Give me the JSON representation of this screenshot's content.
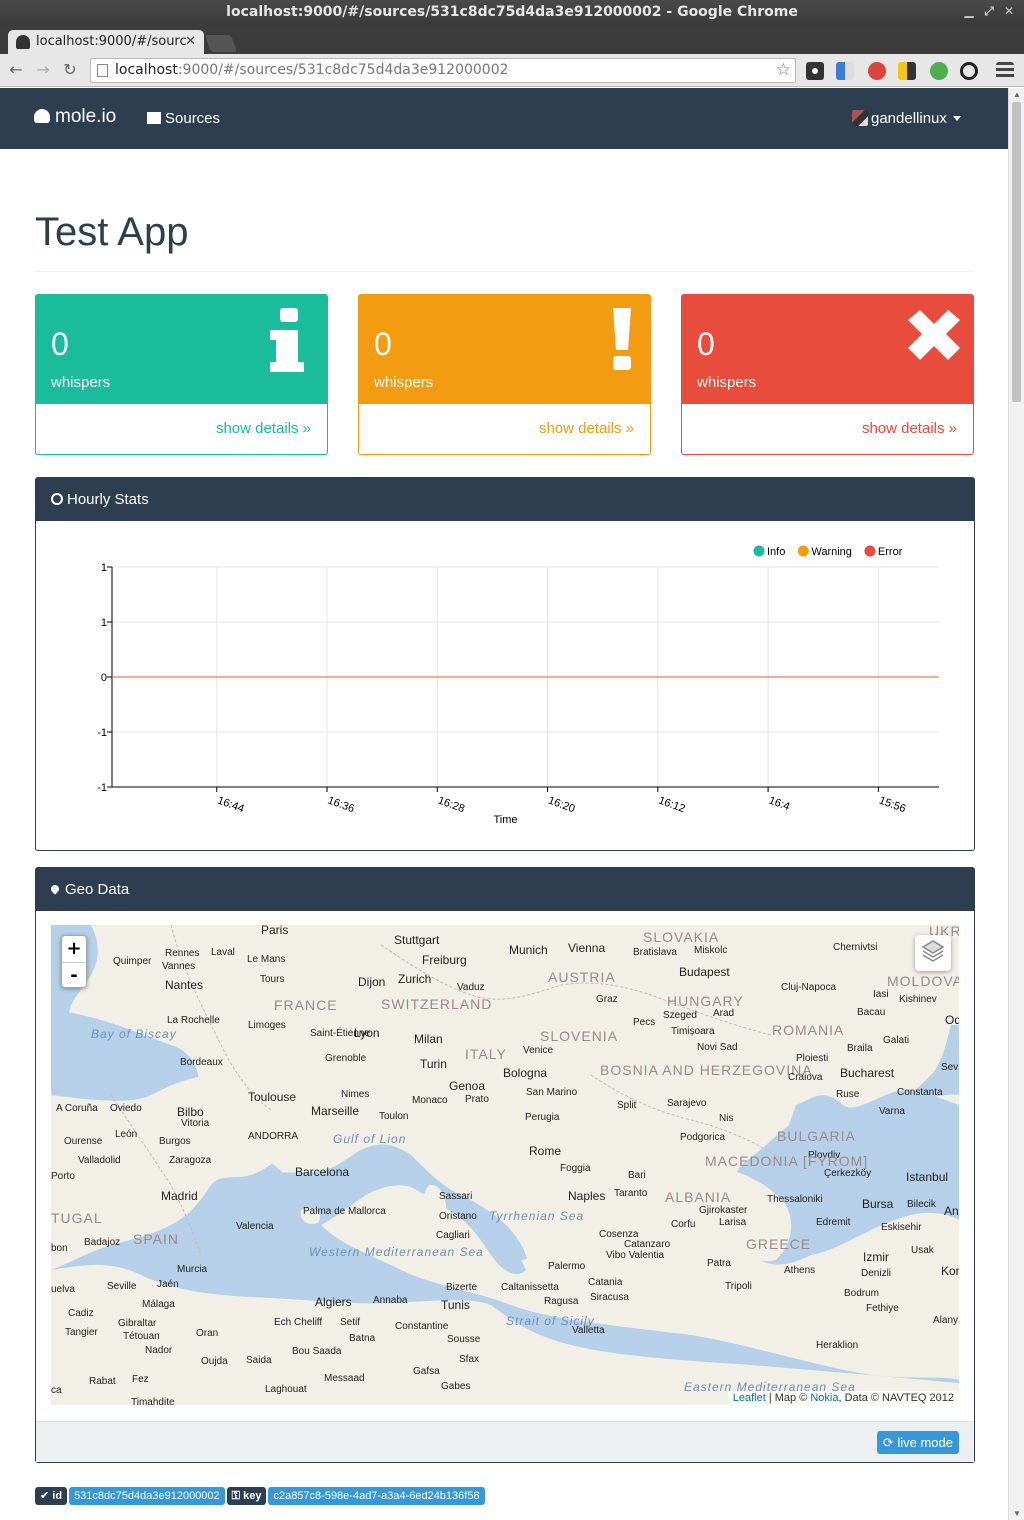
{
  "window": {
    "title": "localhost:9000/#/sources/531c8dc75d4da3e912000002 - Google Chrome"
  },
  "tab": {
    "title": "localhost:9000/#/sourc"
  },
  "omnibox": {
    "host": "localhost",
    "path": ":9000/#/sources/531c8dc75d4da3e912000002"
  },
  "navbar": {
    "brand": "mole.io",
    "sources": "Sources",
    "user": "gandellinux"
  },
  "page": {
    "title": "Test App"
  },
  "cards": [
    {
      "count": "0",
      "label": "whispers",
      "link": "show details »",
      "color": "#1abc9c",
      "icon": "info-icon"
    },
    {
      "count": "0",
      "label": "whispers",
      "link": "show details »",
      "color": "#f39c12",
      "icon": "exclamation-icon"
    },
    {
      "count": "0",
      "label": "whispers",
      "link": "show details »",
      "color": "#e74c3c",
      "icon": "times-icon"
    }
  ],
  "stats_panel": {
    "title": "Hourly Stats"
  },
  "chart_data": {
    "type": "line",
    "title": "",
    "xlabel": "Time",
    "ylabel": "",
    "categories": [
      "16:44",
      "16:36",
      "16:28",
      "16:20",
      "16:12",
      "16:4",
      "15:56"
    ],
    "yticks": [
      "1",
      "1",
      "0",
      "-1",
      "-1"
    ],
    "ylim": [
      -1,
      1
    ],
    "series": [
      {
        "name": "Info",
        "color": "#1abc9c",
        "values": [
          0,
          0,
          0,
          0,
          0,
          0,
          0
        ]
      },
      {
        "name": "Warning",
        "color": "#f39c12",
        "values": [
          0,
          0,
          0,
          0,
          0,
          0,
          0
        ]
      },
      {
        "name": "Error",
        "color": "#e74c3c",
        "values": [
          0,
          0,
          0,
          0,
          0,
          0,
          0
        ]
      }
    ],
    "grid": true,
    "legend": "top-right"
  },
  "geo_panel": {
    "title": "Geo Data",
    "live_mode": "live mode"
  },
  "map": {
    "attribution_leaflet": "Leaflet",
    "attribution_mid": " | Map © ",
    "attribution_nokia": "Nokia",
    "attribution_end": ", Data © NAVTEQ 2012",
    "labels": {
      "paris": "Paris",
      "stuttgart": "Stuttgart",
      "munich": "Munich",
      "vienna": "Vienna",
      "slovakia": "SLOVAKIA",
      "bratislava": "Bratislava",
      "miskolc": "Miskolc",
      "budapest": "Budapest",
      "chernivtsi": "Chernivtsi",
      "rennes": "Rennes",
      "quimper": "Quimper",
      "vannes": "Vannes",
      "laval": "Laval",
      "lemans": "Le Mans",
      "freiburg": "Freiburg",
      "austria": "AUSTRIA",
      "clujnapoca": "Cluj-Napoca",
      "moldova": "MOLDOVA",
      "nantes": "Nantes",
      "tours": "Tours",
      "dijon": "Dijon",
      "zurich": "Zurich",
      "vaduz": "Vaduz",
      "graz": "Graz",
      "hungary": "HUNGARY",
      "iasi": "Iasi",
      "kishinev": "Kishinev",
      "france": "FRANCE",
      "switzerland": "SWITZERLAND",
      "pecs": "Pecs",
      "szeged": "Szeged",
      "arad": "Arad",
      "bacau": "Bacau",
      "bayofbiscay": "Bay of Biscay",
      "larochelle": "La Rochelle",
      "limoges": "Limoges",
      "saintetienne": "Saint-Étienne",
      "lyon": "Lyon",
      "milan": "Milan",
      "slovenia": "SLOVENIA",
      "timisoara": "Timișoara",
      "romania": "ROMANIA",
      "galati": "Galati",
      "grenoble": "Grenoble",
      "italy": "ITALY",
      "venice": "Venice",
      "novisad": "Novi Sad",
      "braila": "Braila",
      "bordeaux": "Bordeaux",
      "turin": "Turin",
      "bosnia": "BOSNIA AND HERZEGOVINA",
      "ploiesti": "Ploiesti",
      "craiova": "Craiova",
      "bucharest": "Bucharest",
      "bologna": "Bologna",
      "genoa": "Genoa",
      "sanmarino": "San Marino",
      "constanta": "Constanta",
      "toulouse": "Toulouse",
      "nimes": "Nimes",
      "monaco": "Monaco",
      "prato": "Prato",
      "split": "Split",
      "sarajevo": "Sarajevo",
      "ruse": "Ruse",
      "acoruna": "A Coruña",
      "oviedo": "Oviedo",
      "bilbo": "Bilbo",
      "vitoria": "Vitoria",
      "marseille": "Marseille",
      "toulon": "Toulon",
      "perugia": "Perugia",
      "nis": "Nis",
      "varna": "Varna",
      "ourense": "Ourense",
      "leon": "León",
      "burgos": "Burgos",
      "andorra": "ANDORRA",
      "gulfoflion": "Gulf of Lion",
      "podgorica": "Podgorica",
      "bulgaria": "BULGARIA",
      "vallad": "Valladolid",
      "zaragoza": "Zaragoza",
      "rome": "Rome",
      "plovdiv": "Plovdiv",
      "macedonia": "MACEDONIA [FYROM]",
      "porto": "Porto",
      "barcelona": "Barcelona",
      "foggia": "Foggia",
      "bari": "Bari",
      "cerkezkoy": "Çerkezköy",
      "istanbul": "Istanbul",
      "madrid": "Madrid",
      "naples": "Naples",
      "taranto": "Taranto",
      "albania": "ALBANIA",
      "thessaloniki": "Thessaloniki",
      "bursa": "Bursa",
      "sassari": "Sassari",
      "gjirokaster": "Gjirokaster",
      "bilecik": "Bilecik",
      "portugal": "TUGAL",
      "palma": "Palma de Mallorca",
      "oristano": "Oristano",
      "tyrrhenian": "Tyrrhenian Sea",
      "corfu": "Corfu",
      "larisa": "Larisa",
      "edremit": "Edremit",
      "eskisehir": "Eskisehir",
      "badajoz": "Badajoz",
      "valencia": "Valencia",
      "spain": "SPAIN",
      "cagliari": "Cagliari",
      "cosenza": "Cosenza",
      "greece": "GREECE",
      "lisbon": "bon",
      "westmed": "Western Mediterranean Sea",
      "catanzaro": "Catanzaro",
      "vibo": "Vibo Valentia",
      "usak": "Usak",
      "izmir": "Izmir",
      "murcia": "Murcia",
      "palermo": "Palermo",
      "patra": "Patra",
      "athens": "Athens",
      "denizli": "Denizli",
      "seville": "Seville",
      "jaen": "Jaén",
      "caltanissetta": "Caltanissetta",
      "catania": "Catania",
      "bizerte": "Bizerte",
      "tripoli": "Tripoli",
      "bodrum": "Bodrum",
      "huelva": "uelva",
      "malaga": "Málaga",
      "algiers": "Algiers",
      "annaba": "Annaba",
      "tunis": "Tunis",
      "ragusa": "Ragusa",
      "siracusa": "Siracusa",
      "fethiye": "Fethiye",
      "cadiz": "Cadiz",
      "gibraltar": "Gibraltar",
      "echcheliff": "Ech Cheliff",
      "setif": "Setif",
      "constantine": "Constantine",
      "straitsicily": "Strait of Sicily",
      "valletta": "Valletta",
      "tangier": "Tangier",
      "tetouan": "Tétouan",
      "oran": "Oran",
      "batna": "Batna",
      "sousse": "Sousse",
      "nador": "Nador",
      "bousaada": "Bou Saada",
      "heraklion": "Heraklion",
      "oujda": "Oujda",
      "saida": "Saida",
      "sfax": "Sfax",
      "messaad": "Messaad",
      "gafsa": "Gafsa",
      "rabat": "Rabat",
      "fez": "Fez",
      "laghouat": "Laghouat",
      "gabes": "Gabes",
      "easternmed": "Eastern Mediterranean Sea",
      "casa": "ca",
      "timahdite": "Timahdite",
      "ukr": "UKR",
      "od": "Od",
      "sev": "Sev",
      "an": "An",
      "kor": "Kor",
      "alany": "Alany"
    }
  },
  "footer_labels": {
    "id_label": "id",
    "id_value": "531c8dc75d4da3e912000002",
    "key_label": "key",
    "key_value": "c2a857c8-598e-4ad7-a3a4-6ed24b136f58"
  }
}
